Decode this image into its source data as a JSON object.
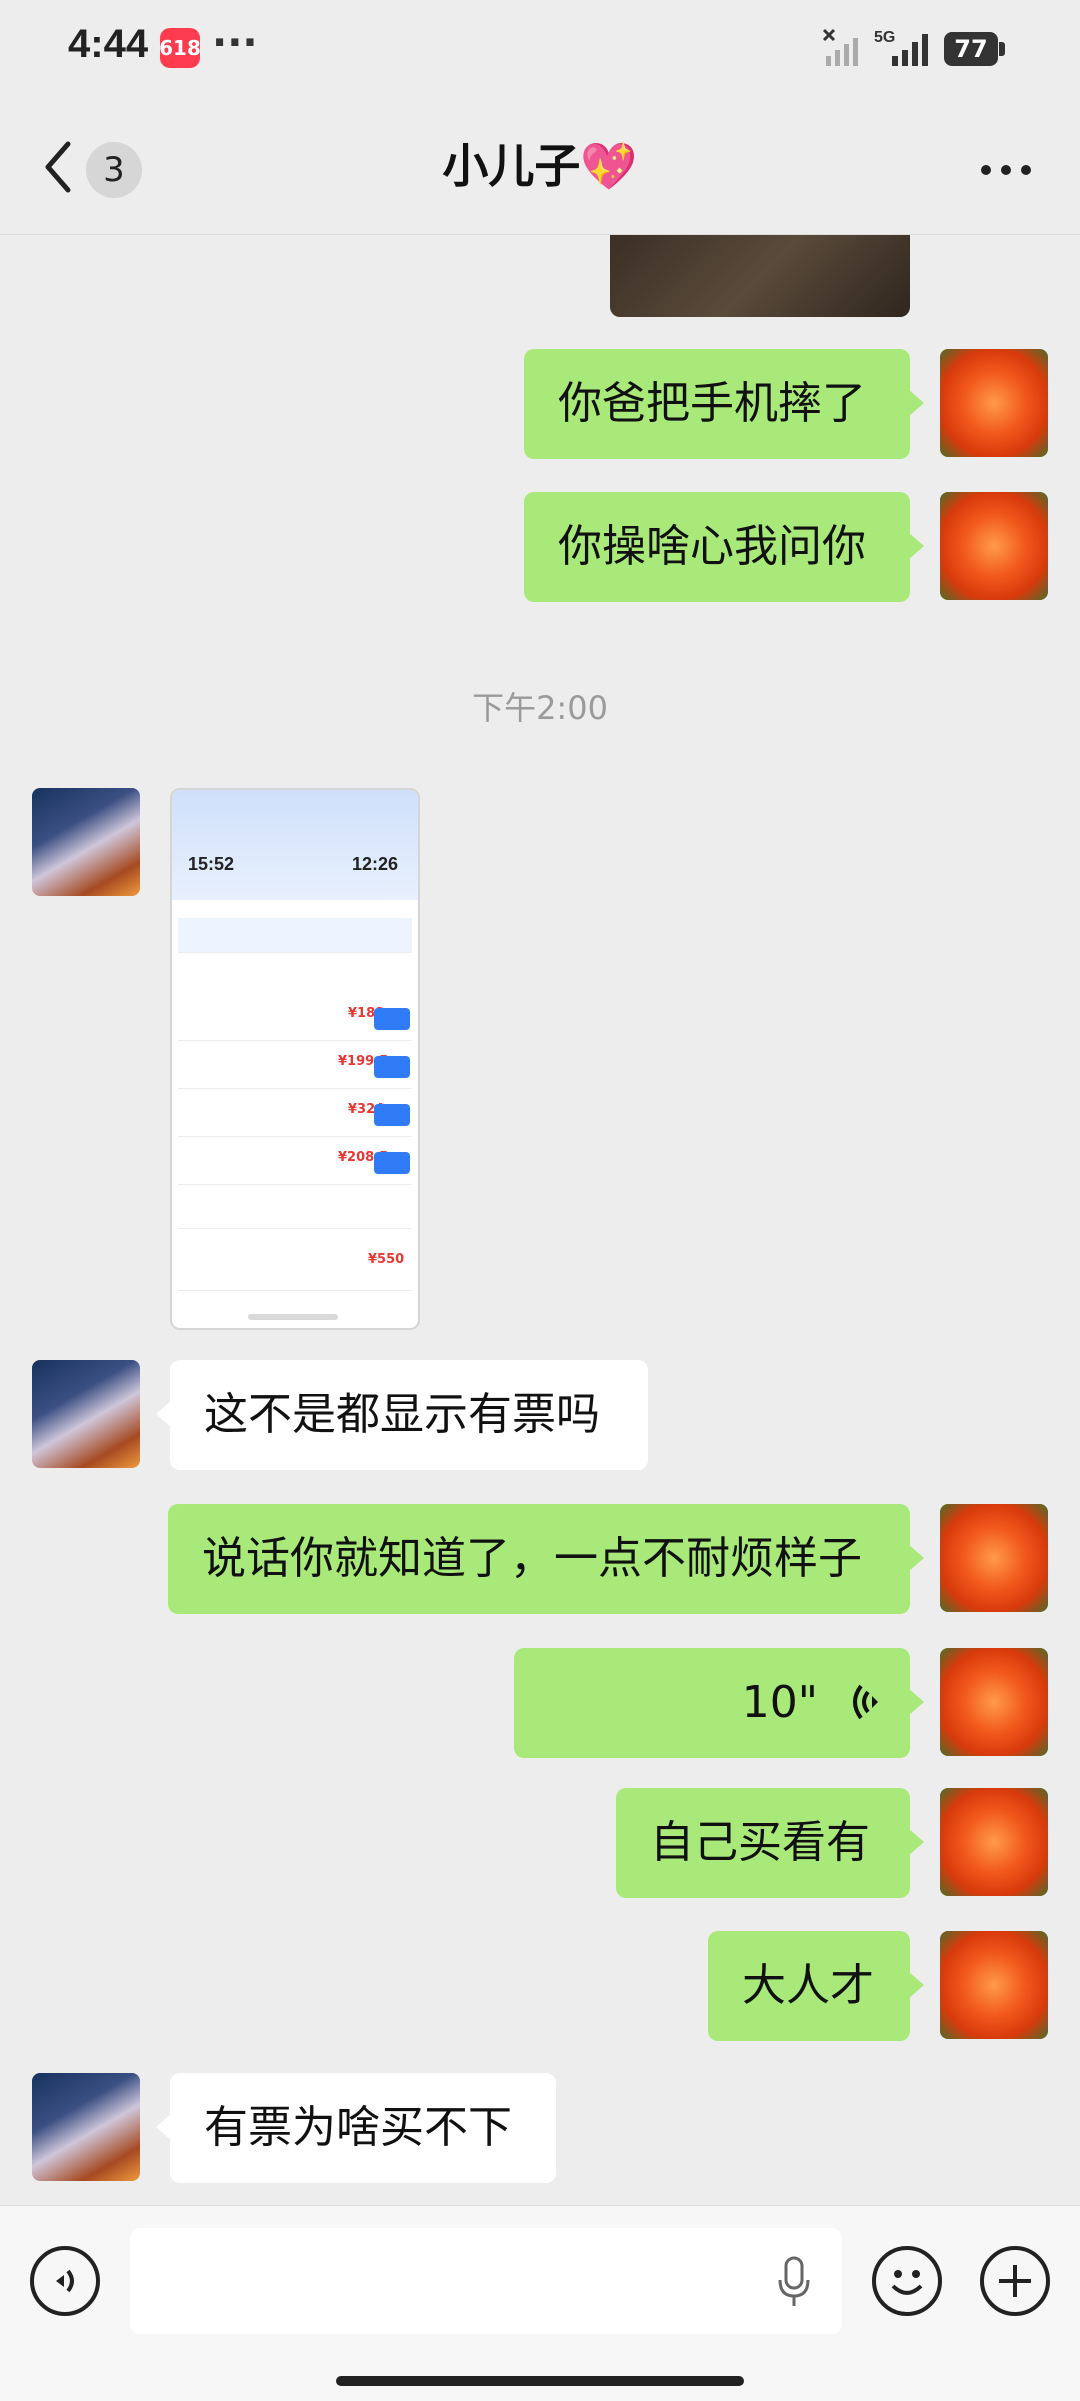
{
  "status_bar": {
    "time": "4:44",
    "badge": "618",
    "dots": "···",
    "network": "5G",
    "battery": "77"
  },
  "header": {
    "back_count": "3",
    "title": "小儿子💖"
  },
  "timestamp": "下午2:00",
  "messages": {
    "m1": "你爸把手机摔了",
    "m2": "你操啥心我问你",
    "m3": "这不是都显示有票吗",
    "m4": "说话你就知道了，一点不耐烦样子",
    "m5_voice": "10\"",
    "m6": "自己买看有",
    "m7": "大人才",
    "m8": "有票为啥买不下"
  },
  "screenshot": {
    "depart_time": "15:52",
    "arrive_time": "12:26",
    "prices": [
      "¥188",
      "¥199.5",
      "¥324",
      "¥208.5",
      "¥550"
    ]
  },
  "colors": {
    "my_bubble": "#a9e97a",
    "other_bubble": "#ffffff",
    "background": "#ededed"
  }
}
